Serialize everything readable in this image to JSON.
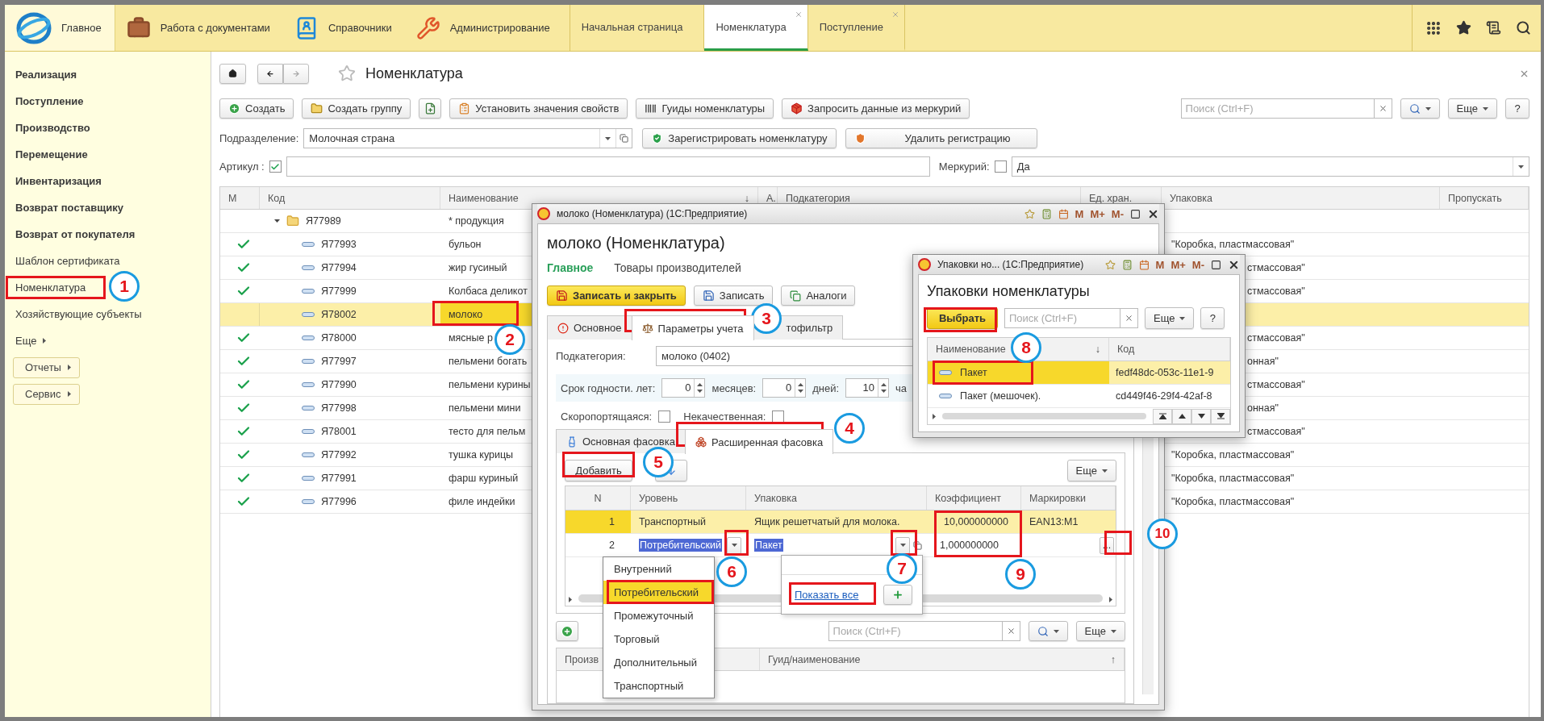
{
  "top_bar": {
    "sections": [
      {
        "label": "Главное",
        "selected": true
      },
      {
        "label": "Работа с документами",
        "selected": false
      },
      {
        "label": "Справочники",
        "selected": false
      },
      {
        "label": "Администрирование",
        "selected": false
      }
    ],
    "tabs": [
      {
        "label": "Начальная страница",
        "selected": false,
        "closable": false
      },
      {
        "label": "Номенклатура",
        "selected": true,
        "closable": true
      },
      {
        "label": "Поступление",
        "selected": false,
        "closable": true
      }
    ]
  },
  "sidebar": {
    "items": [
      {
        "label": "Реализация",
        "kind": "section"
      },
      {
        "label": "Поступление",
        "kind": "section"
      },
      {
        "label": "Производство",
        "kind": "section"
      },
      {
        "label": "Перемещение",
        "kind": "section"
      },
      {
        "label": "Инвентаризация",
        "kind": "section"
      },
      {
        "label": "Возврат поставщику",
        "kind": "section"
      },
      {
        "label": "Возврат от покупателя",
        "kind": "section"
      },
      {
        "label": "Шаблон сертификата",
        "kind": "link"
      },
      {
        "label": "Номенклатура",
        "kind": "link"
      },
      {
        "label": "Хозяйствующие субъекты",
        "kind": "link"
      },
      {
        "label": "Еще",
        "kind": "submenu"
      },
      {
        "label": "Отчеты",
        "kind": "button"
      },
      {
        "label": "Сервис",
        "kind": "button"
      }
    ]
  },
  "page": {
    "title": "Номенклатура",
    "toolbar": [
      {
        "kind": "text",
        "label": "Создать"
      },
      {
        "kind": "text",
        "label": "Создать группу"
      },
      {
        "kind": "icon"
      },
      {
        "kind": "text",
        "label": "Установить значения свойств"
      },
      {
        "kind": "text",
        "label": "Гуиды номенклатуры"
      },
      {
        "kind": "text",
        "label": "Запросить данные из меркурий"
      }
    ],
    "search": {
      "placeholder": "Поиск (Ctrl+F)"
    },
    "more": "Еще",
    "help": "?",
    "subdivision": {
      "label": "Подразделение:",
      "value": "Молочная страна"
    },
    "register_buttons": [
      "Зарегистрировать номенклатуру",
      "Удалить регистрацию"
    ],
    "article": {
      "label": "Артикул :",
      "checked": true
    },
    "mercury": {
      "label": "Меркурий:",
      "checked": false,
      "value": "Да"
    }
  },
  "table": {
    "columns": [
      {
        "label": "М"
      },
      {
        "label": "Код"
      },
      {
        "label": "Наименование",
        "sort_mark": "↓"
      },
      {
        "label": "А."
      },
      {
        "label": "Подкатегория"
      },
      {
        "label": "Ед. хран."
      },
      {
        "label": "Упаковка"
      },
      {
        "label": "Пропускать"
      }
    ],
    "rows": [
      {
        "kind": "group",
        "expanded": true,
        "marked": false,
        "selected": false,
        "code": "Я77989",
        "name": "* продукция"
      },
      {
        "kind": "item",
        "marked": true,
        "selected": false,
        "code": "Я77993",
        "name": "бульон",
        "packaging": "\"Коробка, пластмассовая\"",
        "packaging_hidden_start": false
      },
      {
        "kind": "item",
        "marked": true,
        "selected": false,
        "code": "Я77994",
        "name": "жир гусиный",
        "packaging": "стмассовая\"",
        "packaging_hidden_start": true
      },
      {
        "kind": "item",
        "marked": true,
        "selected": false,
        "code": "Я77999",
        "name": "Колбаса деликот",
        "packaging": "стмассовая\"",
        "packaging_hidden_start": true
      },
      {
        "kind": "item",
        "marked": false,
        "selected": true,
        "code": "Я78002",
        "name": "молоко"
      },
      {
        "kind": "item",
        "marked": true,
        "selected": false,
        "code": "Я78000",
        "name": "мясные р",
        "packaging": "стмассовая\"",
        "packaging_hidden_start": true
      },
      {
        "kind": "item",
        "marked": true,
        "selected": false,
        "code": "Я77997",
        "name": "пельмени богать",
        "packaging": "онная\"",
        "packaging_hidden_start": true
      },
      {
        "kind": "item",
        "marked": true,
        "selected": false,
        "code": "Я77990",
        "name": "пельмени курины",
        "packaging": "стмассовая\"",
        "packaging_hidden_start": true
      },
      {
        "kind": "item",
        "marked": true,
        "selected": false,
        "code": "Я77998",
        "name": "пельмени мини",
        "packaging": "онная\"",
        "packaging_hidden_start": true
      },
      {
        "kind": "item",
        "marked": true,
        "selected": false,
        "code": "Я78001",
        "name": "тесто для пельм",
        "packaging": "стмассовая\"",
        "packaging_hidden_start": true
      },
      {
        "kind": "item",
        "marked": true,
        "selected": false,
        "code": "Я77992",
        "name": "тушка курицы",
        "packaging": "\"Коробка, пластмассовая\"",
        "packaging_hidden_start": false
      },
      {
        "kind": "item",
        "marked": true,
        "selected": false,
        "code": "Я77991",
        "name": "фарш куриный",
        "packaging": "\"Коробка, пластмассовая\"",
        "packaging_hidden_start": false
      },
      {
        "kind": "item",
        "marked": true,
        "selected": false,
        "code": "Я77996",
        "name": "филе индейки",
        "packaging": "\"Коробка, пластмассовая\"",
        "packaging_hidden_start": false
      }
    ]
  },
  "item_window": {
    "title": "молоко (Номенклатура)  (1С:Предприятие)",
    "title_buttons": [
      "M",
      "M+",
      "M-"
    ],
    "heading": "молоко (Номенклатура)",
    "nav": [
      {
        "label": "Главное",
        "selected": true
      },
      {
        "label": "Товары производителей",
        "selected": false
      }
    ],
    "buttons": [
      {
        "label": "Записать и закрыть",
        "kind": "primary"
      },
      {
        "label": "Записать",
        "kind": "normal"
      },
      {
        "label": "Аналоги",
        "kind": "normal"
      }
    ],
    "tabs": [
      {
        "label": "Основное",
        "selected": false
      },
      {
        "label": "Параметры учета",
        "selected": true
      },
      {
        "label": "тофильтр",
        "selected": false,
        "hidden_start": true
      }
    ],
    "subcategory": {
      "label": "Подкатегория:",
      "value": "молоко (0402)"
    },
    "shelf_life": [
      {
        "label": "Срок годности. лет:",
        "value": "0"
      },
      {
        "label": "месяцев:",
        "value": "0"
      },
      {
        "label": "дней:",
        "value": "10"
      },
      {
        "label": "ча"
      }
    ],
    "flags": [
      {
        "label": "Скоропортящаяся:",
        "checked": false
      },
      {
        "label": "Некачественная:",
        "checked": false
      }
    ],
    "pack_tabs": [
      {
        "label": "Основная фасовка",
        "selected": false
      },
      {
        "label": "Расширенная фасовка",
        "selected": true
      }
    ],
    "pack_toolbar": {
      "add": "Добавить",
      "more": "Еще"
    },
    "pack_grid": {
      "columns": [
        "N",
        "Уровень",
        "Упаковка",
        "Коэффициент",
        "Маркировки"
      ],
      "rows": [
        {
          "n": "1",
          "level": "Транспортный",
          "package": "Ящик решетчатый для молока.",
          "ratio": "10,000000000",
          "marking": "EAN13:M1",
          "selected": true,
          "editing": false
        },
        {
          "n": "2",
          "level": "Потребительский",
          "package": "Пакет",
          "ratio": "1,000000000",
          "choice_button": "...",
          "selected": false,
          "editing": true
        }
      ]
    },
    "producers": {
      "search_placeholder": "Поиск (Ctrl+F)",
      "more": "Еще",
      "columns": [
        {
          "label": "Произв"
        },
        {
          "label": "Гуид/наименование",
          "sort_mark": "↑"
        }
      ]
    }
  },
  "level_dropdown": {
    "items": [
      {
        "label": "Внутренний",
        "selected": false
      },
      {
        "label": "Потребительский",
        "selected": true
      },
      {
        "label": "Промежуточный",
        "selected": false
      },
      {
        "label": "Торговый",
        "selected": false
      },
      {
        "label": "Дополнительный",
        "selected": false
      },
      {
        "label": "Транспортный",
        "selected": false
      }
    ]
  },
  "package_popup": {
    "link": "Показать все"
  },
  "packages_window": {
    "title": "Упаковки но...  (1С:Предприятие)",
    "title_buttons": [
      "M",
      "M+",
      "M-"
    ],
    "heading": "Упаковки номенклатуры",
    "select": "Выбрать",
    "search_placeholder": "Поиск (Ctrl+F)",
    "more": "Еще",
    "help": "?",
    "columns": [
      {
        "label": "Наименование",
        "sort_mark": "↓"
      },
      {
        "label": "Код"
      }
    ],
    "rows": [
      {
        "name": "Пакет",
        "code": "fedf48dc-053c-11e1-9",
        "selected": true
      },
      {
        "name": "Пакет (мешочек).",
        "code": "cd449f46-29f4-42af-8",
        "selected": false
      }
    ]
  },
  "callouts": [
    {
      "number": "1"
    },
    {
      "number": "2"
    },
    {
      "number": "3"
    },
    {
      "number": "4"
    },
    {
      "number": "5"
    },
    {
      "number": "6"
    },
    {
      "number": "7"
    },
    {
      "number": "8"
    },
    {
      "number": "9"
    },
    {
      "number": "10"
    }
  ]
}
